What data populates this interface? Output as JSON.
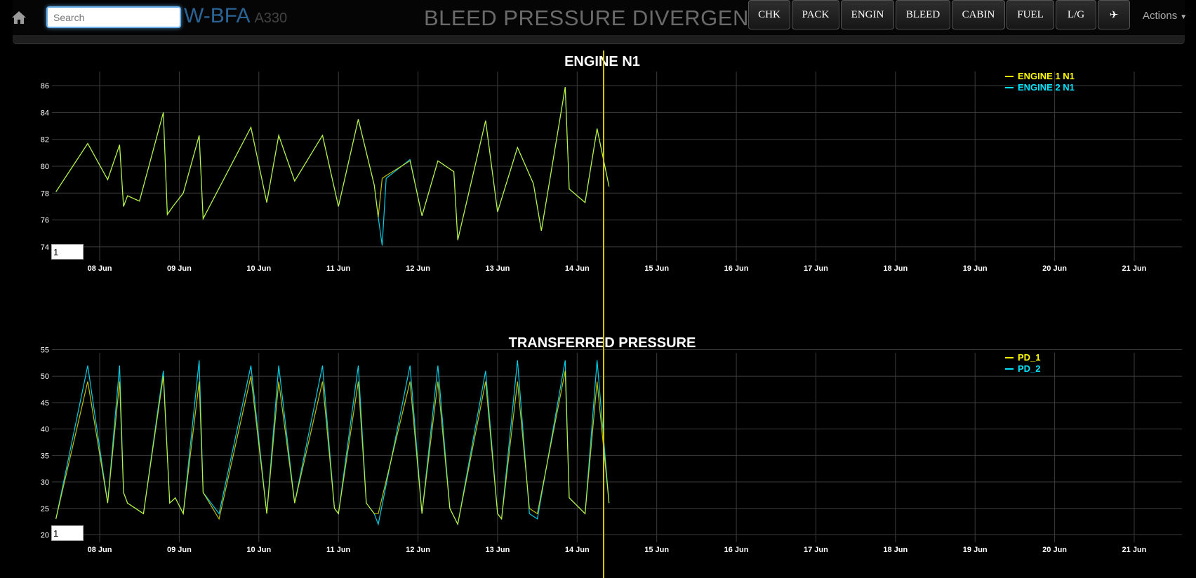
{
  "header": {
    "search_placeholder": "Search",
    "registration": "W-BFA",
    "aircraft_type": "A330",
    "page_title": "BLEED PRESSURE DIVERGENCE",
    "nav_buttons": [
      "CHK",
      "PACK",
      "ENGIN",
      "BLEED",
      "CABIN",
      "FUEL",
      "L/G",
      "✈"
    ],
    "actions_label": "Actions"
  },
  "chart_data": [
    {
      "type": "line",
      "title": "ENGINE N1",
      "x_ticks": [
        "08 Jun",
        "09 Jun",
        "10 Jun",
        "11 Jun",
        "12 Jun",
        "13 Jun",
        "14 Jun",
        "15 Jun",
        "16 Jun",
        "17 Jun",
        "18 Jun",
        "19 Jun",
        "20 Jun",
        "21 Jun"
      ],
      "y_ticks": [
        74,
        76,
        78,
        80,
        82,
        84,
        86
      ],
      "ylim": [
        73,
        87
      ],
      "xlim_days": [
        7.4,
        21.6
      ],
      "grid": true,
      "legend_position": "top-right",
      "zoom_value": "1",
      "series": [
        {
          "name": "ENGINE 1 N1",
          "color": "#ffff00",
          "x": [
            7.45,
            7.85,
            8.1,
            8.25,
            8.3,
            8.35,
            8.5,
            8.8,
            8.85,
            8.92,
            9.05,
            9.25,
            9.3,
            9.9,
            10.1,
            10.25,
            10.45,
            10.8,
            11.0,
            11.25,
            11.45,
            11.5,
            11.55,
            11.6,
            11.9,
            12.05,
            12.25,
            12.45,
            12.5,
            12.85,
            13.0,
            13.25,
            13.45,
            13.55,
            13.85,
            13.9,
            14.1,
            14.25,
            14.4
          ],
          "y": [
            78.1,
            81.7,
            79,
            81.6,
            77,
            77.8,
            77.4,
            84,
            76.4,
            77,
            78,
            82.3,
            76.1,
            82.9,
            77.3,
            82.3,
            78.9,
            82.3,
            77,
            83.5,
            78.6,
            76.2,
            79.1,
            79.3,
            80.4,
            76.3,
            80.4,
            79.6,
            74.5,
            83.4,
            76.6,
            81.4,
            78.7,
            75.2,
            85.9,
            78.3,
            77.3,
            82.8,
            78.5
          ]
        },
        {
          "name": "ENGINE 2 N1",
          "color": "#00e5ff",
          "x": [
            7.45,
            7.85,
            8.1,
            8.25,
            8.3,
            8.35,
            8.5,
            8.8,
            8.85,
            8.92,
            9.05,
            9.25,
            9.3,
            9.9,
            10.1,
            10.25,
            10.45,
            10.8,
            11.0,
            11.25,
            11.45,
            11.5,
            11.55,
            11.6,
            11.9,
            12.05,
            12.25,
            12.45,
            12.5,
            12.85,
            13.0,
            13.25,
            13.45,
            13.55,
            13.85,
            13.9,
            14.1,
            14.25,
            14.4
          ],
          "y": [
            78.1,
            81.7,
            79,
            81.6,
            77,
            77.8,
            77.4,
            84,
            76.4,
            77,
            78,
            82.3,
            76.1,
            82.9,
            77.3,
            82.3,
            78.9,
            82.3,
            77,
            83.5,
            78.6,
            76.2,
            74.1,
            79.1,
            80.5,
            76.3,
            80.4,
            79.6,
            74.5,
            83.4,
            76.6,
            81.4,
            78.7,
            75.2,
            85.9,
            78.3,
            77.3,
            82.8,
            78.5
          ]
        }
      ]
    },
    {
      "type": "line",
      "title": "TRANSFERRED PRESSURE",
      "x_ticks": [
        "08 Jun",
        "09 Jun",
        "10 Jun",
        "11 Jun",
        "12 Jun",
        "13 Jun",
        "14 Jun",
        "15 Jun",
        "16 Jun",
        "17 Jun",
        "18 Jun",
        "19 Jun",
        "20 Jun",
        "21 Jun"
      ],
      "y_ticks": [
        20,
        25,
        30,
        35,
        40,
        45,
        50,
        55
      ],
      "ylim": [
        19,
        56
      ],
      "xlim_days": [
        7.4,
        21.6
      ],
      "grid": true,
      "legend_position": "top-right",
      "zoom_value": "1",
      "series": [
        {
          "name": "PD_1",
          "color": "#ffff00",
          "x": [
            7.45,
            7.85,
            8.1,
            8.25,
            8.3,
            8.35,
            8.55,
            8.8,
            8.88,
            8.95,
            9.05,
            9.25,
            9.3,
            9.5,
            9.9,
            10.1,
            10.25,
            10.45,
            10.8,
            10.95,
            11.0,
            11.25,
            11.35,
            11.45,
            11.5,
            11.9,
            12.05,
            12.25,
            12.4,
            12.5,
            12.85,
            13.0,
            13.05,
            13.25,
            13.4,
            13.5,
            13.85,
            13.9,
            14.1,
            14.25,
            14.4
          ],
          "y": [
            23,
            49,
            26,
            49,
            28,
            26,
            24,
            50,
            26,
            27,
            24,
            49,
            28,
            23,
            50,
            24,
            49,
            26,
            49,
            25,
            24,
            49,
            26,
            24,
            24,
            49,
            24,
            49,
            25,
            22,
            49,
            24,
            23,
            49,
            25,
            24,
            51,
            27,
            24,
            49,
            26
          ]
        },
        {
          "name": "PD_2",
          "color": "#00e5ff",
          "x": [
            7.45,
            7.85,
            8.1,
            8.25,
            8.3,
            8.35,
            8.55,
            8.8,
            8.88,
            8.95,
            9.05,
            9.25,
            9.3,
            9.5,
            9.9,
            10.1,
            10.25,
            10.45,
            10.8,
            10.95,
            11.0,
            11.25,
            11.35,
            11.45,
            11.5,
            11.9,
            12.05,
            12.25,
            12.4,
            12.5,
            12.85,
            13.0,
            13.05,
            13.25,
            13.4,
            13.5,
            13.85,
            13.9,
            14.1,
            14.25,
            14.4
          ],
          "y": [
            23,
            52,
            26,
            52,
            28,
            26,
            24,
            51,
            26,
            27,
            24,
            53,
            28,
            24,
            52,
            24,
            52,
            26,
            52,
            25,
            24,
            52,
            26,
            24,
            22,
            52,
            24,
            52,
            25,
            22,
            51,
            24,
            23,
            53,
            24,
            23,
            53,
            27,
            24,
            53,
            26
          ]
        }
      ]
    }
  ]
}
